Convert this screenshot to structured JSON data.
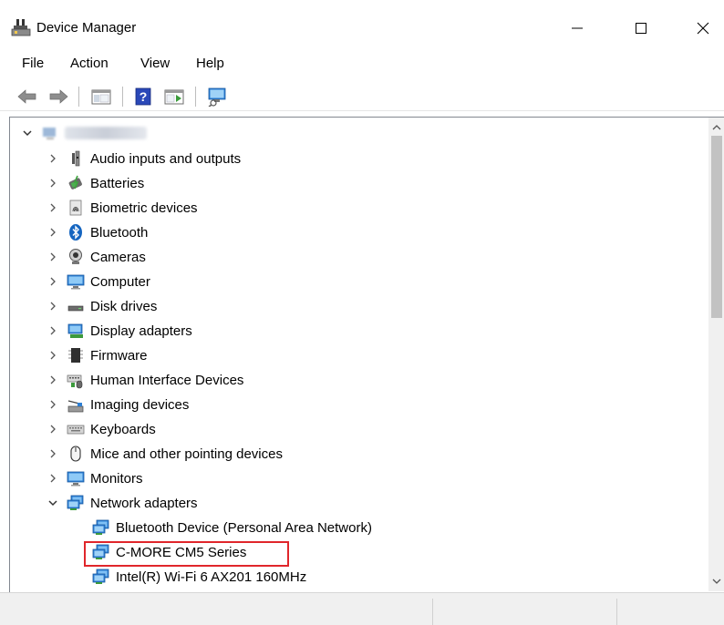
{
  "window": {
    "title": "Device Manager",
    "icon": "device-manager-icon"
  },
  "menu": [
    "File",
    "Action",
    "View",
    "Help"
  ],
  "toolbar": {
    "buttons": [
      "back-arrow-icon",
      "forward-arrow-icon",
      "show-hide-console-tree-icon",
      "help-icon",
      "properties-icon",
      "scan-hardware-icon"
    ]
  },
  "tree": {
    "root_expanded": true,
    "categories": [
      {
        "label": "Audio inputs and outputs",
        "icon": "speaker-icon",
        "expanded": false
      },
      {
        "label": "Batteries",
        "icon": "battery-icon",
        "expanded": false
      },
      {
        "label": "Biometric devices",
        "icon": "fingerprint-icon",
        "expanded": false
      },
      {
        "label": "Bluetooth",
        "icon": "bluetooth-icon",
        "expanded": false
      },
      {
        "label": "Cameras",
        "icon": "camera-icon",
        "expanded": false
      },
      {
        "label": "Computer",
        "icon": "monitor-icon",
        "expanded": false
      },
      {
        "label": "Disk drives",
        "icon": "disk-drive-icon",
        "expanded": false
      },
      {
        "label": "Display adapters",
        "icon": "display-adapter-icon",
        "expanded": false
      },
      {
        "label": "Firmware",
        "icon": "chip-icon",
        "expanded": false
      },
      {
        "label": "Human Interface Devices",
        "icon": "hid-icon",
        "expanded": false
      },
      {
        "label": "Imaging devices",
        "icon": "scanner-icon",
        "expanded": false
      },
      {
        "label": "Keyboards",
        "icon": "keyboard-icon",
        "expanded": false
      },
      {
        "label": "Mice and other pointing devices",
        "icon": "mouse-icon",
        "expanded": false
      },
      {
        "label": "Monitors",
        "icon": "monitor-icon",
        "expanded": false
      },
      {
        "label": "Network adapters",
        "icon": "network-adapter-icon",
        "expanded": true
      }
    ],
    "network_adapters": [
      {
        "label": "Bluetooth Device (Personal Area Network)",
        "icon": "network-adapter-icon",
        "highlighted": false
      },
      {
        "label": "C-MORE CM5 Series",
        "icon": "network-adapter-icon",
        "highlighted": true
      },
      {
        "label": "Intel(R) Wi-Fi 6 AX201 160MHz",
        "icon": "network-adapter-icon",
        "highlighted": false
      }
    ]
  },
  "colors": {
    "highlight_border": "#e0262b",
    "network_icon": "#2d7fd4",
    "bluetooth": "#1565c0"
  }
}
